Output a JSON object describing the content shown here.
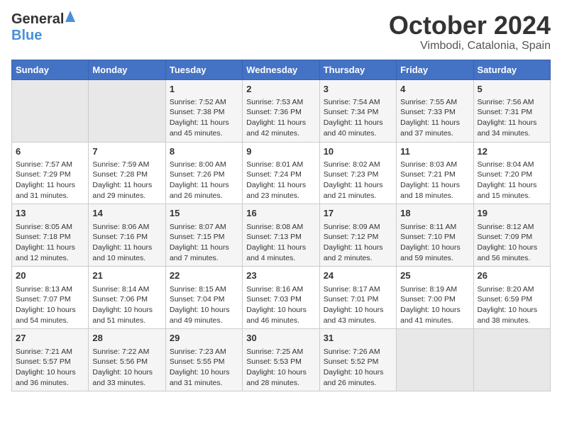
{
  "header": {
    "logo_general": "General",
    "logo_blue": "Blue",
    "month": "October 2024",
    "location": "Vimbodi, Catalonia, Spain"
  },
  "days_of_week": [
    "Sunday",
    "Monday",
    "Tuesday",
    "Wednesday",
    "Thursday",
    "Friday",
    "Saturday"
  ],
  "weeks": [
    [
      {
        "day": "",
        "sunrise": "",
        "sunset": "",
        "daylight": ""
      },
      {
        "day": "",
        "sunrise": "",
        "sunset": "",
        "daylight": ""
      },
      {
        "day": "1",
        "sunrise": "Sunrise: 7:52 AM",
        "sunset": "Sunset: 7:38 PM",
        "daylight": "Daylight: 11 hours and 45 minutes."
      },
      {
        "day": "2",
        "sunrise": "Sunrise: 7:53 AM",
        "sunset": "Sunset: 7:36 PM",
        "daylight": "Daylight: 11 hours and 42 minutes."
      },
      {
        "day": "3",
        "sunrise": "Sunrise: 7:54 AM",
        "sunset": "Sunset: 7:34 PM",
        "daylight": "Daylight: 11 hours and 40 minutes."
      },
      {
        "day": "4",
        "sunrise": "Sunrise: 7:55 AM",
        "sunset": "Sunset: 7:33 PM",
        "daylight": "Daylight: 11 hours and 37 minutes."
      },
      {
        "day": "5",
        "sunrise": "Sunrise: 7:56 AM",
        "sunset": "Sunset: 7:31 PM",
        "daylight": "Daylight: 11 hours and 34 minutes."
      }
    ],
    [
      {
        "day": "6",
        "sunrise": "Sunrise: 7:57 AM",
        "sunset": "Sunset: 7:29 PM",
        "daylight": "Daylight: 11 hours and 31 minutes."
      },
      {
        "day": "7",
        "sunrise": "Sunrise: 7:59 AM",
        "sunset": "Sunset: 7:28 PM",
        "daylight": "Daylight: 11 hours and 29 minutes."
      },
      {
        "day": "8",
        "sunrise": "Sunrise: 8:00 AM",
        "sunset": "Sunset: 7:26 PM",
        "daylight": "Daylight: 11 hours and 26 minutes."
      },
      {
        "day": "9",
        "sunrise": "Sunrise: 8:01 AM",
        "sunset": "Sunset: 7:24 PM",
        "daylight": "Daylight: 11 hours and 23 minutes."
      },
      {
        "day": "10",
        "sunrise": "Sunrise: 8:02 AM",
        "sunset": "Sunset: 7:23 PM",
        "daylight": "Daylight: 11 hours and 21 minutes."
      },
      {
        "day": "11",
        "sunrise": "Sunrise: 8:03 AM",
        "sunset": "Sunset: 7:21 PM",
        "daylight": "Daylight: 11 hours and 18 minutes."
      },
      {
        "day": "12",
        "sunrise": "Sunrise: 8:04 AM",
        "sunset": "Sunset: 7:20 PM",
        "daylight": "Daylight: 11 hours and 15 minutes."
      }
    ],
    [
      {
        "day": "13",
        "sunrise": "Sunrise: 8:05 AM",
        "sunset": "Sunset: 7:18 PM",
        "daylight": "Daylight: 11 hours and 12 minutes."
      },
      {
        "day": "14",
        "sunrise": "Sunrise: 8:06 AM",
        "sunset": "Sunset: 7:16 PM",
        "daylight": "Daylight: 11 hours and 10 minutes."
      },
      {
        "day": "15",
        "sunrise": "Sunrise: 8:07 AM",
        "sunset": "Sunset: 7:15 PM",
        "daylight": "Daylight: 11 hours and 7 minutes."
      },
      {
        "day": "16",
        "sunrise": "Sunrise: 8:08 AM",
        "sunset": "Sunset: 7:13 PM",
        "daylight": "Daylight: 11 hours and 4 minutes."
      },
      {
        "day": "17",
        "sunrise": "Sunrise: 8:09 AM",
        "sunset": "Sunset: 7:12 PM",
        "daylight": "Daylight: 11 hours and 2 minutes."
      },
      {
        "day": "18",
        "sunrise": "Sunrise: 8:11 AM",
        "sunset": "Sunset: 7:10 PM",
        "daylight": "Daylight: 10 hours and 59 minutes."
      },
      {
        "day": "19",
        "sunrise": "Sunrise: 8:12 AM",
        "sunset": "Sunset: 7:09 PM",
        "daylight": "Daylight: 10 hours and 56 minutes."
      }
    ],
    [
      {
        "day": "20",
        "sunrise": "Sunrise: 8:13 AM",
        "sunset": "Sunset: 7:07 PM",
        "daylight": "Daylight: 10 hours and 54 minutes."
      },
      {
        "day": "21",
        "sunrise": "Sunrise: 8:14 AM",
        "sunset": "Sunset: 7:06 PM",
        "daylight": "Daylight: 10 hours and 51 minutes."
      },
      {
        "day": "22",
        "sunrise": "Sunrise: 8:15 AM",
        "sunset": "Sunset: 7:04 PM",
        "daylight": "Daylight: 10 hours and 49 minutes."
      },
      {
        "day": "23",
        "sunrise": "Sunrise: 8:16 AM",
        "sunset": "Sunset: 7:03 PM",
        "daylight": "Daylight: 10 hours and 46 minutes."
      },
      {
        "day": "24",
        "sunrise": "Sunrise: 8:17 AM",
        "sunset": "Sunset: 7:01 PM",
        "daylight": "Daylight: 10 hours and 43 minutes."
      },
      {
        "day": "25",
        "sunrise": "Sunrise: 8:19 AM",
        "sunset": "Sunset: 7:00 PM",
        "daylight": "Daylight: 10 hours and 41 minutes."
      },
      {
        "day": "26",
        "sunrise": "Sunrise: 8:20 AM",
        "sunset": "Sunset: 6:59 PM",
        "daylight": "Daylight: 10 hours and 38 minutes."
      }
    ],
    [
      {
        "day": "27",
        "sunrise": "Sunrise: 7:21 AM",
        "sunset": "Sunset: 5:57 PM",
        "daylight": "Daylight: 10 hours and 36 minutes."
      },
      {
        "day": "28",
        "sunrise": "Sunrise: 7:22 AM",
        "sunset": "Sunset: 5:56 PM",
        "daylight": "Daylight: 10 hours and 33 minutes."
      },
      {
        "day": "29",
        "sunrise": "Sunrise: 7:23 AM",
        "sunset": "Sunset: 5:55 PM",
        "daylight": "Daylight: 10 hours and 31 minutes."
      },
      {
        "day": "30",
        "sunrise": "Sunrise: 7:25 AM",
        "sunset": "Sunset: 5:53 PM",
        "daylight": "Daylight: 10 hours and 28 minutes."
      },
      {
        "day": "31",
        "sunrise": "Sunrise: 7:26 AM",
        "sunset": "Sunset: 5:52 PM",
        "daylight": "Daylight: 10 hours and 26 minutes."
      },
      {
        "day": "",
        "sunrise": "",
        "sunset": "",
        "daylight": ""
      },
      {
        "day": "",
        "sunrise": "",
        "sunset": "",
        "daylight": ""
      }
    ]
  ]
}
